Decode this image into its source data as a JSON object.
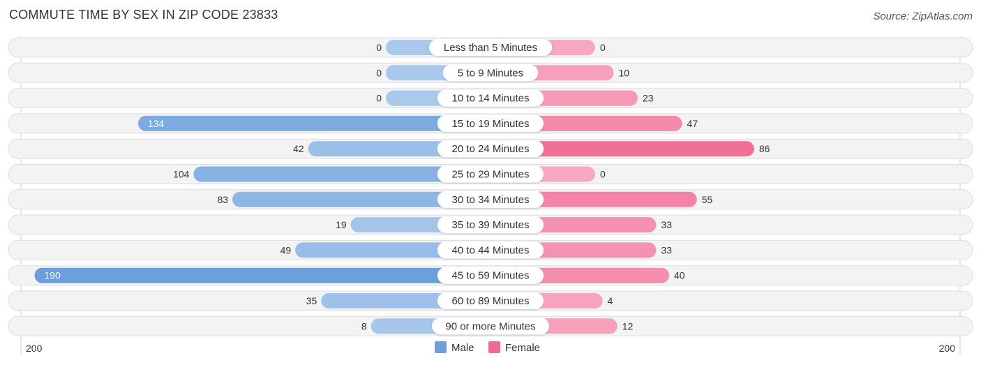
{
  "title": "COMMUTE TIME BY SEX IN ZIP CODE 23833",
  "source": "Source: ZipAtlas.com",
  "colors": {
    "male": "#6a9fdb",
    "male_light": "#aac8ec",
    "female": "#f06a94",
    "female_light": "#f7a8c0",
    "row_bg": "#f2f2f2",
    "text": "#333333"
  },
  "chart_data": {
    "type": "bar",
    "orientation": "horizontal-diverging",
    "title": "COMMUTE TIME BY SEX IN ZIP CODE 23833",
    "categories": [
      "Less than 5 Minutes",
      "5 to 9 Minutes",
      "10 to 14 Minutes",
      "15 to 19 Minutes",
      "20 to 24 Minutes",
      "25 to 29 Minutes",
      "30 to 34 Minutes",
      "35 to 39 Minutes",
      "40 to 44 Minutes",
      "45 to 59 Minutes",
      "60 to 89 Minutes",
      "90 or more Minutes"
    ],
    "series": [
      {
        "name": "Male",
        "side": "left",
        "values": [
          0,
          0,
          0,
          134,
          42,
          104,
          83,
          19,
          49,
          190,
          35,
          8
        ]
      },
      {
        "name": "Female",
        "side": "right",
        "values": [
          0,
          10,
          23,
          47,
          86,
          0,
          55,
          33,
          33,
          40,
          4,
          12
        ]
      }
    ],
    "axis": {
      "left_max_label": "200",
      "right_max_label": "200",
      "range": [
        0,
        200
      ]
    },
    "legend": {
      "position": "bottom-center",
      "entries": [
        "Male",
        "Female"
      ]
    },
    "xlabel": "",
    "ylabel": ""
  }
}
